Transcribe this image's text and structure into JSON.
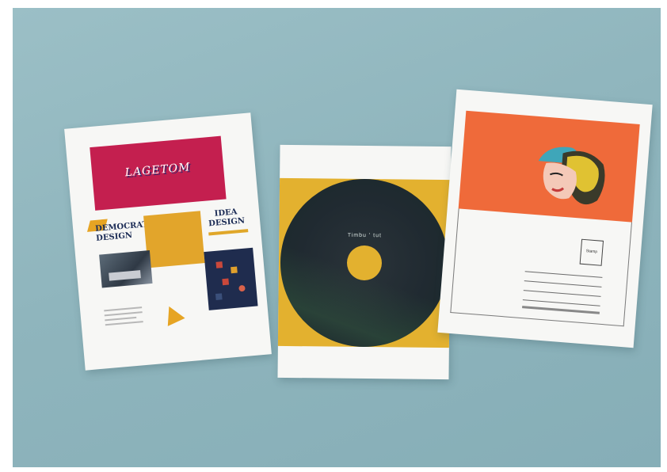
{
  "scene": {
    "background_color": "#8fb5bd",
    "items": [
      "brochure",
      "cd-sleeve",
      "postcard"
    ]
  },
  "brochure": {
    "banner_text": "LAGETOM",
    "banner_color": "#c41f4f",
    "left_title": "DEMOCRATIC DESIGN",
    "right_title": "IDEA DESIGN",
    "accent_color": "#e2a52b",
    "navy_color": "#1f2c4e"
  },
  "cd_sleeve": {
    "disc_text": "Timbu ' tut",
    "band_color": "#e3b12f",
    "disc_color": "#202a31"
  },
  "postcard": {
    "art_color": "#ef6a3a",
    "stamp_text": "Stamp"
  }
}
